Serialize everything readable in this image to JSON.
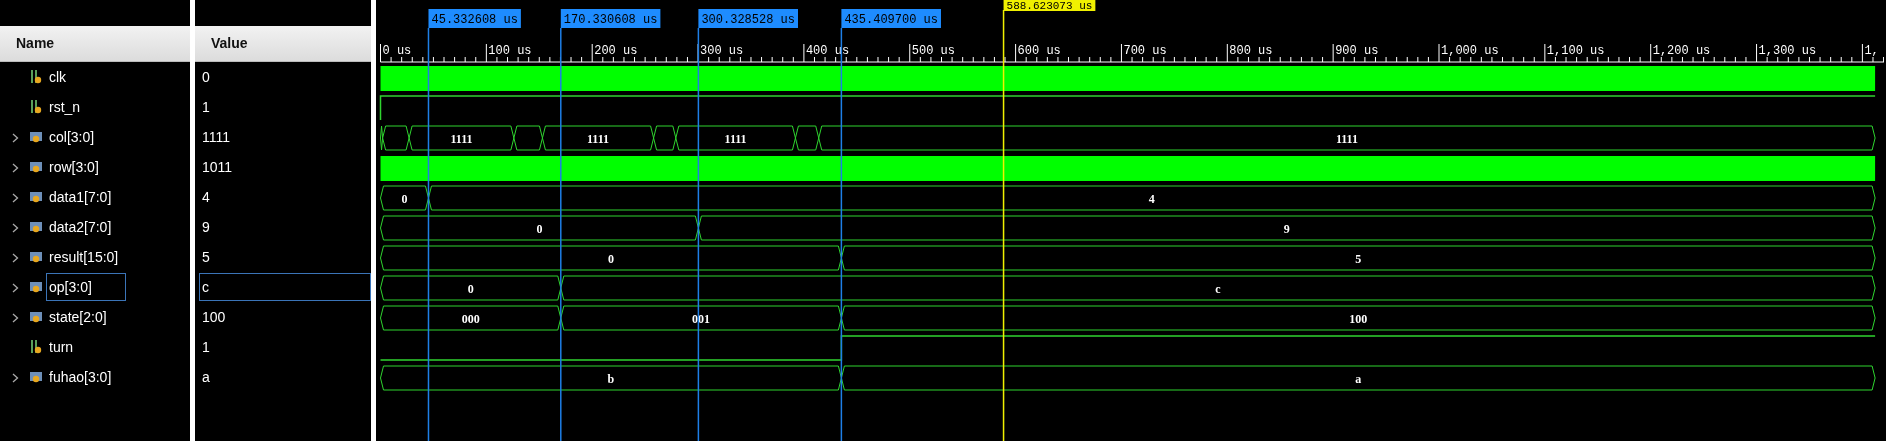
{
  "columns": {
    "name": "Name",
    "value": "Value"
  },
  "signals": [
    {
      "name": "clk",
      "value": "0",
      "kind": "clock",
      "selected": false
    },
    {
      "name": "rst_n",
      "value": "1",
      "kind": "bit",
      "selected": false
    },
    {
      "name": "col[3:0]",
      "value": "1111",
      "kind": "bus",
      "selected": false,
      "wave_labels": [
        "1111",
        "1111",
        "1111",
        "1111"
      ]
    },
    {
      "name": "row[3:0]",
      "value": "1011",
      "kind": "densebus",
      "selected": false
    },
    {
      "name": "data1[7:0]",
      "value": "4",
      "kind": "bus",
      "selected": false,
      "wave_labels": [
        "0",
        "4"
      ]
    },
    {
      "name": "data2[7:0]",
      "value": "9",
      "kind": "bus",
      "selected": false,
      "wave_labels": [
        "0",
        "9"
      ]
    },
    {
      "name": "result[15:0]",
      "value": "5",
      "kind": "bus",
      "selected": false,
      "wave_labels": [
        "0",
        "5"
      ]
    },
    {
      "name": "op[3:0]",
      "value": "c",
      "kind": "bus",
      "selected": true,
      "wave_labels": [
        "0",
        "c"
      ]
    },
    {
      "name": "state[2:0]",
      "value": "100",
      "kind": "bus",
      "selected": false,
      "wave_labels": [
        "000",
        "001",
        "100"
      ]
    },
    {
      "name": "turn",
      "value": "1",
      "kind": "bit",
      "selected": false
    },
    {
      "name": "fuhao[3:0]",
      "value": "a",
      "kind": "bus",
      "selected": false,
      "wave_labels": [
        "b",
        "a"
      ]
    }
  ],
  "markers": [
    "45.332608 us",
    "170.330608 us",
    "300.328528 us",
    "435.409700 us"
  ],
  "cursor": "588.623073 us",
  "ruler": [
    "0 us",
    "100 us",
    "200 us",
    "300 us",
    "400 us",
    "500 us",
    "600 us",
    "700 us",
    "800 us",
    "900 us",
    "1,000 us",
    "1,100 us",
    "1,200 us",
    "1,300 us",
    "1,"
  ]
}
